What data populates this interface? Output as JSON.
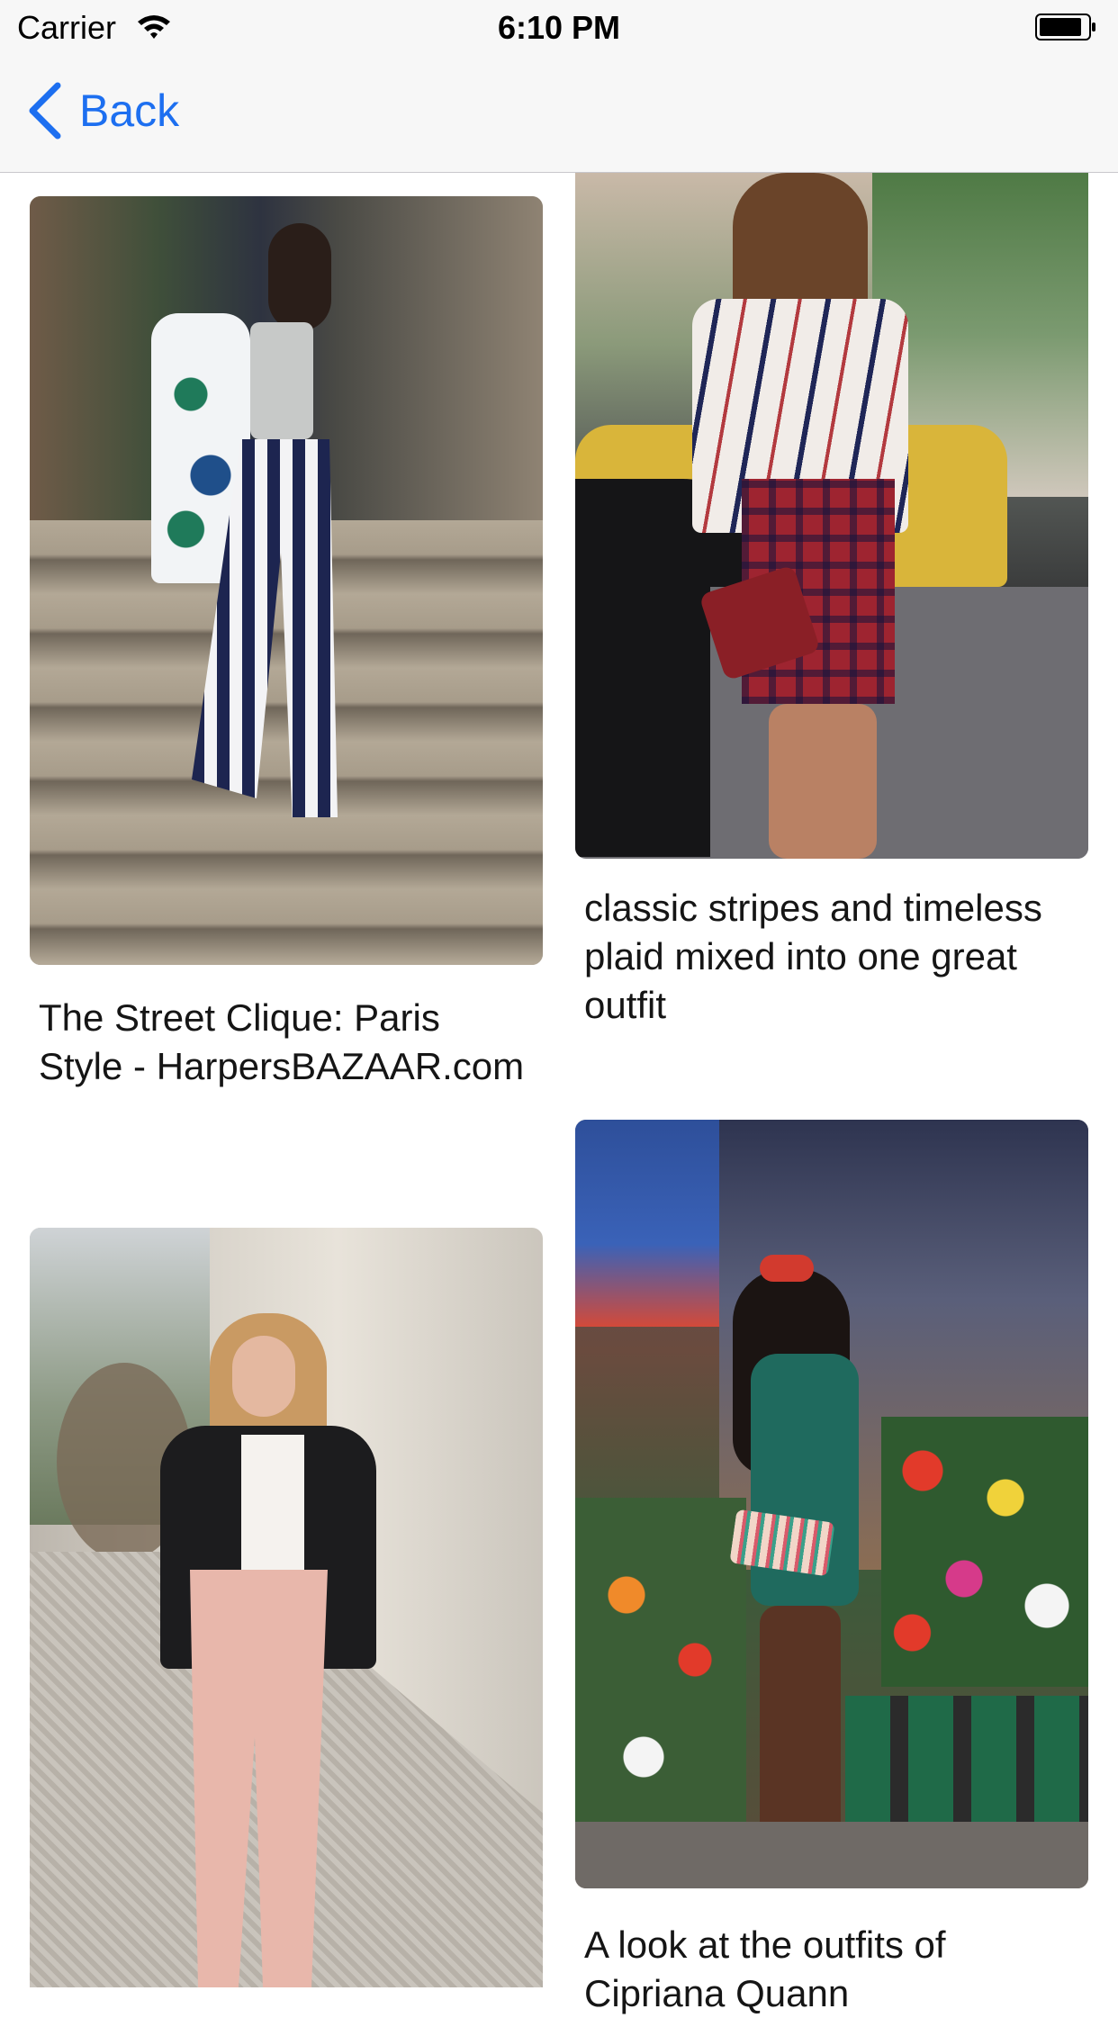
{
  "status_bar": {
    "carrier": "Carrier",
    "time": "6:10 PM"
  },
  "nav": {
    "back_label": "Back"
  },
  "cards": [
    {
      "caption": "The Street Clique: Paris Style - HarpersBAZAAR.com",
      "image": "woman in floral coat and striped trousers on stone steps"
    },
    {
      "caption": "classic stripes and timeless plaid mixed into one great outfit",
      "image": "woman in striped blouse and plaid skirt on street"
    },
    {
      "caption": "",
      "image": "woman in leather jacket and pink trousers on cobblestone street"
    },
    {
      "caption": "A look at the outfits of Cipriana Quann",
      "image": "woman in green dress in front of flower shop"
    }
  ],
  "colors": {
    "accent": "#1d6ff0",
    "nav_background": "#f7f7f7"
  }
}
